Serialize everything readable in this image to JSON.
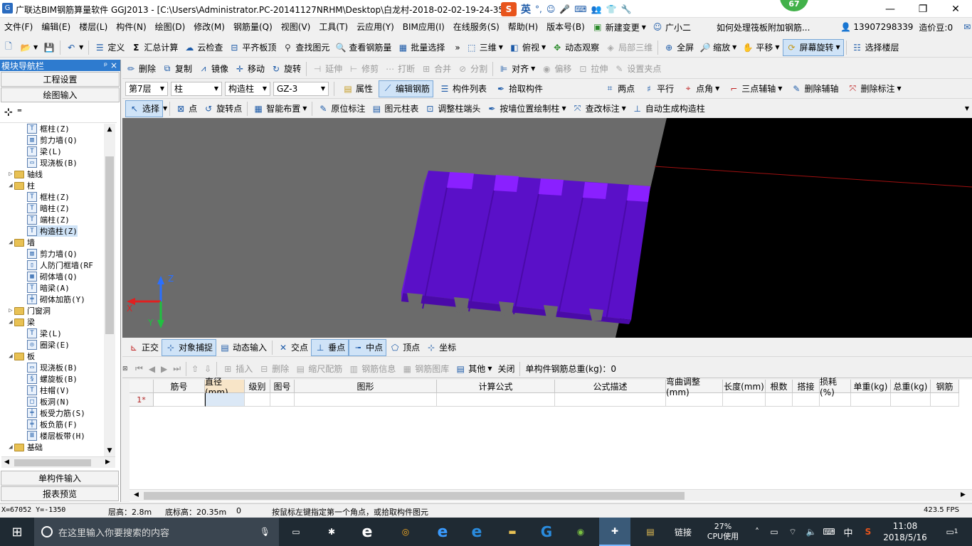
{
  "window": {
    "title": "广联达BIM钢筋算量软件 GGJ2013 - [C:\\Users\\Administrator.PC-20141127NRHM\\Desktop\\白龙村-2018-02-02-19-24-35",
    "ime_label": "英",
    "badge_count": "67",
    "minimize": "—",
    "restore": "❐",
    "close": "✕"
  },
  "menu": {
    "items": [
      "文件(F)",
      "编辑(E)",
      "楼层(L)",
      "构件(N)",
      "绘图(D)",
      "修改(M)",
      "钢筋量(Q)",
      "视图(V)",
      "工具(T)",
      "云应用(Y)",
      "BIM应用(I)",
      "在线服务(S)",
      "帮助(H)",
      "版本号(B)"
    ],
    "new_change": "新建变更",
    "assistant": "广小二",
    "notice": "如何处理筏板附加钢筋...",
    "phone": "13907298339",
    "cost_beans": "造价豆:0"
  },
  "toolbar1": {
    "define": "定义",
    "sum": "汇总计算",
    "cloud_check": "云检查",
    "flush_top": "平齐板顶",
    "find": "查找图元",
    "view_rebar": "查看钢筋量",
    "batch_select": "批量选择",
    "three_d": "三维",
    "top_view": "俯视",
    "dynamic_view": "动态观察",
    "partial_3d": "局部三维",
    "fullscreen": "全屏",
    "zoom": "缩放",
    "pan": "平移",
    "screen_rotate": "屏幕旋转",
    "select_floor": "选择楼层"
  },
  "toolbar2": {
    "delete": "删除",
    "copy": "复制",
    "mirror": "镜像",
    "move": "移动",
    "rotate": "旋转",
    "extend": "延伸",
    "trim": "修剪",
    "break": "打断",
    "merge": "合并",
    "split": "分割",
    "align": "对齐",
    "offset": "偏移",
    "stretch": "拉伸",
    "set_grip": "设置夹点"
  },
  "toolbar3": {
    "floor": "第7层",
    "category": "柱",
    "type": "构造柱",
    "name": "GZ-3",
    "property": "属性",
    "edit_rebar": "编辑钢筋",
    "component_list": "构件列表",
    "pick": "拾取构件",
    "two_point": "两点",
    "parallel": "平行",
    "point_angle": "点角",
    "three_point_axis": "三点辅轴",
    "delete_axis": "删除辅轴",
    "delete_dim": "删除标注"
  },
  "toolbar4": {
    "select": "选择",
    "point": "点",
    "rotate_point": "旋转点",
    "smart_layout": "智能布置",
    "origin_dim": "原位标注",
    "column_table": "图元柱表",
    "adjust_end": "调整柱端头",
    "draw_by_wall": "按墙位置绘制柱",
    "modify_dim": "查改标注",
    "auto_gen": "自动生成构造柱"
  },
  "nav": {
    "title": "模块导航栏",
    "pin": "ᵖ ×",
    "project_settings": "工程设置",
    "drawing_input": "绘图输入",
    "single_input": "单构件输入",
    "report_preview": "报表预览",
    "tree": [
      {
        "label": "框柱(Z)",
        "level": 2,
        "icon": "column-icon"
      },
      {
        "label": "剪力墙(Q)",
        "level": 2,
        "icon": "wall-icon"
      },
      {
        "label": "梁(L)",
        "level": 2,
        "icon": "beam-icon"
      },
      {
        "label": "现浇板(B)",
        "level": 2,
        "icon": "slab-icon"
      },
      {
        "label": "轴线",
        "level": 1,
        "icon": "folder-icon",
        "toggle": "▷"
      },
      {
        "label": "柱",
        "level": 1,
        "icon": "folder-icon",
        "toggle": "◢"
      },
      {
        "label": "框柱(Z)",
        "level": 2,
        "icon": "column-icon"
      },
      {
        "label": "暗柱(Z)",
        "level": 2,
        "icon": "column-icon"
      },
      {
        "label": "端柱(Z)",
        "level": 2,
        "icon": "column-icon"
      },
      {
        "label": "构造柱(Z)",
        "level": 2,
        "icon": "column-icon",
        "selected": true
      },
      {
        "label": "墙",
        "level": 1,
        "icon": "folder-icon",
        "toggle": "◢"
      },
      {
        "label": "剪力墙(Q)",
        "level": 2,
        "icon": "wall-icon"
      },
      {
        "label": "人防门框墙(RF",
        "level": 2,
        "icon": "door-wall-icon"
      },
      {
        "label": "砌体墙(Q)",
        "level": 2,
        "icon": "masonry-icon"
      },
      {
        "label": "暗梁(A)",
        "level": 2,
        "icon": "beam-icon"
      },
      {
        "label": "砌体加筋(Y)",
        "level": 2,
        "icon": "rebar-icon"
      },
      {
        "label": "门窗洞",
        "level": 1,
        "icon": "folder-icon",
        "toggle": "▷"
      },
      {
        "label": "梁",
        "level": 1,
        "icon": "folder-icon",
        "toggle": "◢"
      },
      {
        "label": "梁(L)",
        "level": 2,
        "icon": "beam-icon"
      },
      {
        "label": "圈梁(E)",
        "level": 2,
        "icon": "ring-beam-icon"
      },
      {
        "label": "板",
        "level": 1,
        "icon": "folder-icon",
        "toggle": "◢"
      },
      {
        "label": "现浇板(B)",
        "level": 2,
        "icon": "slab-icon"
      },
      {
        "label": "螺旋板(B)",
        "level": 2,
        "icon": "spiral-slab-icon"
      },
      {
        "label": "柱帽(V)",
        "level": 2,
        "icon": "column-cap-icon"
      },
      {
        "label": "板洞(N)",
        "level": 2,
        "icon": "slab-hole-icon"
      },
      {
        "label": "板受力筋(S)",
        "level": 2,
        "icon": "rebar-icon"
      },
      {
        "label": "板负筋(F)",
        "level": 2,
        "icon": "rebar-icon"
      },
      {
        "label": "楼层板带(H)",
        "level": 2,
        "icon": "strip-icon"
      },
      {
        "label": "基础",
        "level": 1,
        "icon": "folder-icon",
        "toggle": "◢"
      }
    ]
  },
  "snapbar": {
    "ortho": "正交",
    "object_snap": "对象捕捉",
    "dynamic_input": "动态输入",
    "intersection": "交点",
    "perpendicular": "垂点",
    "midpoint": "中点",
    "vertex": "顶点",
    "coordinate": "坐标"
  },
  "rebar_toolbar": {
    "insert": "插入",
    "delete": "删除",
    "scale_rebar": "缩尺配筋",
    "rebar_info": "钢筋信息",
    "rebar_library": "钢筋图库",
    "other": "其他",
    "close": "关闭",
    "total_weight": "单构件钢筋总重(kg)：0"
  },
  "grid": {
    "columns": [
      "筋号",
      "直径(mm)",
      "级别",
      "图号",
      "图形",
      "计算公式",
      "公式描述",
      "弯曲调整(mm)",
      "长度(mm)",
      "根数",
      "搭接",
      "损耗(%)",
      "单重(kg)",
      "总重(kg)",
      "钢筋"
    ],
    "row1": "1*"
  },
  "axes": {
    "x": "X",
    "y": "Y",
    "z": "Z"
  },
  "status": {
    "coords": "X=67052 Y=-1350",
    "floor_height": "层高：2.8m",
    "base_height": "底标高：20.35m",
    "zero": "0",
    "hint": "按鼠标左键指定第一个角点，或拾取构件图元",
    "fps": "423.5 FPS"
  },
  "taskbar": {
    "search_placeholder": "在这里输入你要搜索的内容",
    "link": "链接",
    "cpu_percent": "27%",
    "cpu_label": "CPU使用",
    "ime": "中",
    "time": "11:08",
    "date": "2018/5/16",
    "notifications": "1"
  }
}
